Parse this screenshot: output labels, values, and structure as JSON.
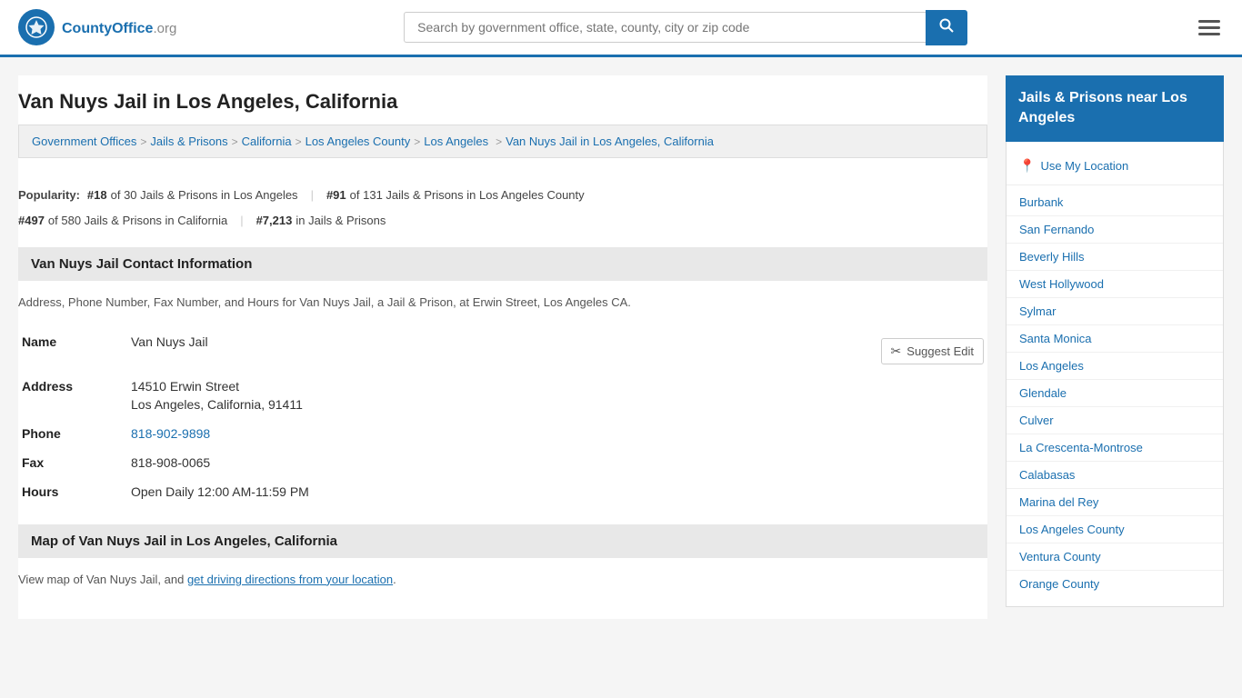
{
  "header": {
    "logo_text": "CountyOffice",
    "logo_suffix": ".org",
    "search_placeholder": "Search by government office, state, county, city or zip code",
    "search_value": ""
  },
  "page": {
    "title": "Van Nuys Jail in Los Angeles, California"
  },
  "breadcrumb": {
    "items": [
      {
        "label": "Government Offices",
        "url": "#"
      },
      {
        "label": "Jails & Prisons",
        "url": "#"
      },
      {
        "label": "California",
        "url": "#"
      },
      {
        "label": "Los Angeles County",
        "url": "#"
      },
      {
        "label": "Los Angeles",
        "url": "#"
      },
      {
        "label": "Van Nuys Jail in Los Angeles, California",
        "url": "#"
      }
    ]
  },
  "popularity": {
    "label": "Popularity:",
    "rank1": "#18",
    "rank1_text": "of 30 Jails & Prisons in Los Angeles",
    "rank2": "#91",
    "rank2_text": "of 131 Jails & Prisons in Los Angeles County",
    "rank3": "#497",
    "rank3_text": "of 580 Jails & Prisons in California",
    "rank4": "#7,213",
    "rank4_text": "in Jails & Prisons"
  },
  "contact_section": {
    "header": "Van Nuys Jail Contact Information",
    "description": "Address, Phone Number, Fax Number, and Hours for Van Nuys Jail, a Jail & Prison, at Erwin Street, Los Angeles CA.",
    "suggest_edit_label": "Suggest Edit",
    "fields": {
      "name_label": "Name",
      "name_value": "Van Nuys Jail",
      "address_label": "Address",
      "address_line1": "14510 Erwin Street",
      "address_line2": "Los Angeles, California, 91411",
      "phone_label": "Phone",
      "phone_value": "818-902-9898",
      "fax_label": "Fax",
      "fax_value": "818-908-0065",
      "hours_label": "Hours",
      "hours_value": "Open Daily 12:00 AM-11:59 PM"
    }
  },
  "map_section": {
    "header": "Map of Van Nuys Jail in Los Angeles, California",
    "description_before": "View map of Van Nuys Jail, and ",
    "description_link": "get driving directions from your location",
    "description_after": "."
  },
  "sidebar": {
    "title": "Jails & Prisons near Los Angeles",
    "use_location_label": "Use My Location",
    "nearby_links": [
      "Burbank",
      "San Fernando",
      "Beverly Hills",
      "West Hollywood",
      "Sylmar",
      "Santa Monica",
      "Los Angeles",
      "Glendale",
      "Culver",
      "La Crescenta-Montrose",
      "Calabasas",
      "Marina del Rey",
      "Los Angeles County",
      "Ventura County",
      "Orange County"
    ]
  }
}
